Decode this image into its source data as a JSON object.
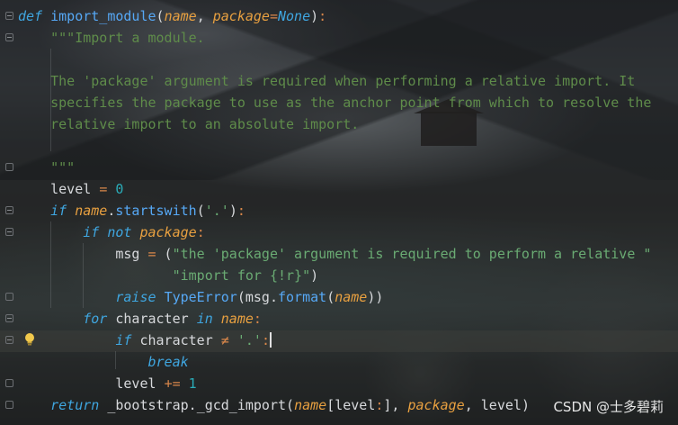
{
  "editor": {
    "line_def_kw": "def",
    "line_def_fn": "import_module",
    "line_def_p1": "name",
    "line_def_p2": "package",
    "line_def_p2_default": "None",
    "doc_line1": "\"\"\"Import a module.",
    "doc_line2": "The 'package' argument is required when performing a relative import. It",
    "doc_line3": "specifies the package to use as the anchor point from which to resolve the",
    "doc_line4": "relative import to an absolute import.",
    "doc_close": "\"\"\"",
    "level_init_var": "level",
    "level_init_val": "0",
    "if1_kw": "if",
    "if1_name": "name",
    "if1_method": "startswith",
    "if1_arg": "'.'",
    "if2_kw": "if not",
    "if2_name": "package",
    "msg_var": "msg",
    "msg_str1": "\"the 'package' argument is required to perform a relative \"",
    "msg_str2": "\"import for {!r}\"",
    "raise_kw": "raise",
    "raise_cls": "TypeError",
    "raise_msg": "msg",
    "raise_method": "format",
    "raise_arg": "name",
    "for_kw": "for",
    "for_var": "character",
    "for_in": "in",
    "for_iter": "name",
    "if3_kw": "if",
    "if3_var": "character",
    "if3_op": "≠",
    "if3_str": "'.'",
    "break_kw": "break",
    "level_incr_var": "level",
    "level_incr_op": "+=",
    "level_incr_val": "1",
    "return_kw": "return",
    "return_obj": "_bootstrap",
    "return_fn": "_gcd_import",
    "return_a1": "name",
    "return_a2": "level",
    "return_a3": "package",
    "return_a4": "level"
  },
  "watermark": "CSDN @士多碧莉",
  "icons": {
    "bulb": "lightbulb-icon",
    "fold": "fold-marker-icon"
  },
  "colors": {
    "keyword": "#3fa6e0",
    "function": "#56a8f5",
    "parameter": "#e8a040",
    "string": "#6aab73",
    "number": "#2aacb8"
  }
}
